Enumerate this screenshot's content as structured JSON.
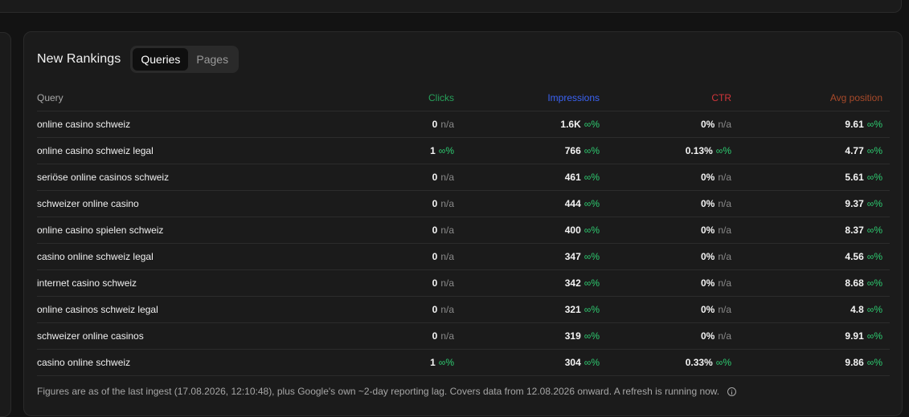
{
  "panel": {
    "title": "New Rankings",
    "tabs": [
      {
        "label": "Queries",
        "active": true
      },
      {
        "label": "Pages",
        "active": false
      }
    ]
  },
  "table": {
    "columns": {
      "query": {
        "label": "Query"
      },
      "clicks": {
        "label": "Clicks",
        "color": "#27a05a"
      },
      "impressions": {
        "label": "Impressions",
        "color": "#3b63f5"
      },
      "ctr": {
        "label": "CTR",
        "color": "#d0353a"
      },
      "avg_position": {
        "label": "Avg position",
        "color": "#a84a2a"
      }
    },
    "rows": [
      {
        "query": "online casino schweiz",
        "clicks": "0",
        "clicks_delta": "n/a",
        "impressions": "1.6K",
        "impressions_delta": "∞%",
        "ctr": "0%",
        "ctr_delta": "n/a",
        "position": "9.61",
        "position_delta": "∞%"
      },
      {
        "query": "online casino schweiz legal",
        "clicks": "1",
        "clicks_delta": "∞%",
        "impressions": "766",
        "impressions_delta": "∞%",
        "ctr": "0.13%",
        "ctr_delta": "∞%",
        "position": "4.77",
        "position_delta": "∞%"
      },
      {
        "query": "seriöse online casinos schweiz",
        "clicks": "0",
        "clicks_delta": "n/a",
        "impressions": "461",
        "impressions_delta": "∞%",
        "ctr": "0%",
        "ctr_delta": "n/a",
        "position": "5.61",
        "position_delta": "∞%"
      },
      {
        "query": "schweizer online casino",
        "clicks": "0",
        "clicks_delta": "n/a",
        "impressions": "444",
        "impressions_delta": "∞%",
        "ctr": "0%",
        "ctr_delta": "n/a",
        "position": "9.37",
        "position_delta": "∞%"
      },
      {
        "query": "online casino spielen schweiz",
        "clicks": "0",
        "clicks_delta": "n/a",
        "impressions": "400",
        "impressions_delta": "∞%",
        "ctr": "0%",
        "ctr_delta": "n/a",
        "position": "8.37",
        "position_delta": "∞%"
      },
      {
        "query": "casino online schweiz legal",
        "clicks": "0",
        "clicks_delta": "n/a",
        "impressions": "347",
        "impressions_delta": "∞%",
        "ctr": "0%",
        "ctr_delta": "n/a",
        "position": "4.56",
        "position_delta": "∞%"
      },
      {
        "query": "internet casino schweiz",
        "clicks": "0",
        "clicks_delta": "n/a",
        "impressions": "342",
        "impressions_delta": "∞%",
        "ctr": "0%",
        "ctr_delta": "n/a",
        "position": "8.68",
        "position_delta": "∞%"
      },
      {
        "query": "online casinos schweiz legal",
        "clicks": "0",
        "clicks_delta": "n/a",
        "impressions": "321",
        "impressions_delta": "∞%",
        "ctr": "0%",
        "ctr_delta": "n/a",
        "position": "4.8",
        "position_delta": "∞%"
      },
      {
        "query": "schweizer online casinos",
        "clicks": "0",
        "clicks_delta": "n/a",
        "impressions": "319",
        "impressions_delta": "∞%",
        "ctr": "0%",
        "ctr_delta": "n/a",
        "position": "9.91",
        "position_delta": "∞%"
      },
      {
        "query": "casino online schweiz",
        "clicks": "1",
        "clicks_delta": "∞%",
        "impressions": "304",
        "impressions_delta": "∞%",
        "ctr": "0.33%",
        "ctr_delta": "∞%",
        "position": "9.86",
        "position_delta": "∞%"
      }
    ]
  },
  "footer": {
    "note": "Figures are as of the last ingest (17.08.2026, 12:10:48), plus Google's own ~2-day reporting lag. Covers data from 12.08.2026 onward. A refresh is running now.",
    "icon": "info-icon"
  },
  "colors": {
    "positive": "#2ecc71",
    "muted": "#8a8a8a"
  }
}
